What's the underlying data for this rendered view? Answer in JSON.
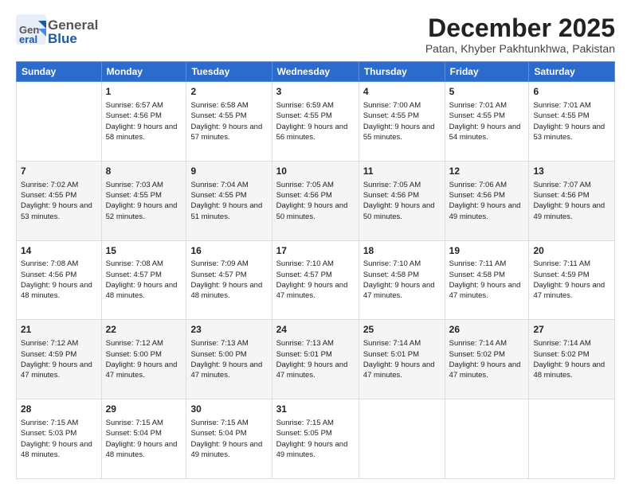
{
  "header": {
    "logo_general": "General",
    "logo_blue": "Blue",
    "month": "December 2025",
    "location": "Patan, Khyber Pakhtunkhwa, Pakistan"
  },
  "weekdays": [
    "Sunday",
    "Monday",
    "Tuesday",
    "Wednesday",
    "Thursday",
    "Friday",
    "Saturday"
  ],
  "weeks": [
    [
      {
        "day": "",
        "sunrise": "",
        "sunset": "",
        "daylight": ""
      },
      {
        "day": "1",
        "sunrise": "Sunrise: 6:57 AM",
        "sunset": "Sunset: 4:56 PM",
        "daylight": "Daylight: 9 hours and 58 minutes."
      },
      {
        "day": "2",
        "sunrise": "Sunrise: 6:58 AM",
        "sunset": "Sunset: 4:55 PM",
        "daylight": "Daylight: 9 hours and 57 minutes."
      },
      {
        "day": "3",
        "sunrise": "Sunrise: 6:59 AM",
        "sunset": "Sunset: 4:55 PM",
        "daylight": "Daylight: 9 hours and 56 minutes."
      },
      {
        "day": "4",
        "sunrise": "Sunrise: 7:00 AM",
        "sunset": "Sunset: 4:55 PM",
        "daylight": "Daylight: 9 hours and 55 minutes."
      },
      {
        "day": "5",
        "sunrise": "Sunrise: 7:01 AM",
        "sunset": "Sunset: 4:55 PM",
        "daylight": "Daylight: 9 hours and 54 minutes."
      },
      {
        "day": "6",
        "sunrise": "Sunrise: 7:01 AM",
        "sunset": "Sunset: 4:55 PM",
        "daylight": "Daylight: 9 hours and 53 minutes."
      }
    ],
    [
      {
        "day": "7",
        "sunrise": "Sunrise: 7:02 AM",
        "sunset": "Sunset: 4:55 PM",
        "daylight": "Daylight: 9 hours and 53 minutes."
      },
      {
        "day": "8",
        "sunrise": "Sunrise: 7:03 AM",
        "sunset": "Sunset: 4:55 PM",
        "daylight": "Daylight: 9 hours and 52 minutes."
      },
      {
        "day": "9",
        "sunrise": "Sunrise: 7:04 AM",
        "sunset": "Sunset: 4:55 PM",
        "daylight": "Daylight: 9 hours and 51 minutes."
      },
      {
        "day": "10",
        "sunrise": "Sunrise: 7:05 AM",
        "sunset": "Sunset: 4:56 PM",
        "daylight": "Daylight: 9 hours and 50 minutes."
      },
      {
        "day": "11",
        "sunrise": "Sunrise: 7:05 AM",
        "sunset": "Sunset: 4:56 PM",
        "daylight": "Daylight: 9 hours and 50 minutes."
      },
      {
        "day": "12",
        "sunrise": "Sunrise: 7:06 AM",
        "sunset": "Sunset: 4:56 PM",
        "daylight": "Daylight: 9 hours and 49 minutes."
      },
      {
        "day": "13",
        "sunrise": "Sunrise: 7:07 AM",
        "sunset": "Sunset: 4:56 PM",
        "daylight": "Daylight: 9 hours and 49 minutes."
      }
    ],
    [
      {
        "day": "14",
        "sunrise": "Sunrise: 7:08 AM",
        "sunset": "Sunset: 4:56 PM",
        "daylight": "Daylight: 9 hours and 48 minutes."
      },
      {
        "day": "15",
        "sunrise": "Sunrise: 7:08 AM",
        "sunset": "Sunset: 4:57 PM",
        "daylight": "Daylight: 9 hours and 48 minutes."
      },
      {
        "day": "16",
        "sunrise": "Sunrise: 7:09 AM",
        "sunset": "Sunset: 4:57 PM",
        "daylight": "Daylight: 9 hours and 48 minutes."
      },
      {
        "day": "17",
        "sunrise": "Sunrise: 7:10 AM",
        "sunset": "Sunset: 4:57 PM",
        "daylight": "Daylight: 9 hours and 47 minutes."
      },
      {
        "day": "18",
        "sunrise": "Sunrise: 7:10 AM",
        "sunset": "Sunset: 4:58 PM",
        "daylight": "Daylight: 9 hours and 47 minutes."
      },
      {
        "day": "19",
        "sunrise": "Sunrise: 7:11 AM",
        "sunset": "Sunset: 4:58 PM",
        "daylight": "Daylight: 9 hours and 47 minutes."
      },
      {
        "day": "20",
        "sunrise": "Sunrise: 7:11 AM",
        "sunset": "Sunset: 4:59 PM",
        "daylight": "Daylight: 9 hours and 47 minutes."
      }
    ],
    [
      {
        "day": "21",
        "sunrise": "Sunrise: 7:12 AM",
        "sunset": "Sunset: 4:59 PM",
        "daylight": "Daylight: 9 hours and 47 minutes."
      },
      {
        "day": "22",
        "sunrise": "Sunrise: 7:12 AM",
        "sunset": "Sunset: 5:00 PM",
        "daylight": "Daylight: 9 hours and 47 minutes."
      },
      {
        "day": "23",
        "sunrise": "Sunrise: 7:13 AM",
        "sunset": "Sunset: 5:00 PM",
        "daylight": "Daylight: 9 hours and 47 minutes."
      },
      {
        "day": "24",
        "sunrise": "Sunrise: 7:13 AM",
        "sunset": "Sunset: 5:01 PM",
        "daylight": "Daylight: 9 hours and 47 minutes."
      },
      {
        "day": "25",
        "sunrise": "Sunrise: 7:14 AM",
        "sunset": "Sunset: 5:01 PM",
        "daylight": "Daylight: 9 hours and 47 minutes."
      },
      {
        "day": "26",
        "sunrise": "Sunrise: 7:14 AM",
        "sunset": "Sunset: 5:02 PM",
        "daylight": "Daylight: 9 hours and 47 minutes."
      },
      {
        "day": "27",
        "sunrise": "Sunrise: 7:14 AM",
        "sunset": "Sunset: 5:02 PM",
        "daylight": "Daylight: 9 hours and 48 minutes."
      }
    ],
    [
      {
        "day": "28",
        "sunrise": "Sunrise: 7:15 AM",
        "sunset": "Sunset: 5:03 PM",
        "daylight": "Daylight: 9 hours and 48 minutes."
      },
      {
        "day": "29",
        "sunrise": "Sunrise: 7:15 AM",
        "sunset": "Sunset: 5:04 PM",
        "daylight": "Daylight: 9 hours and 48 minutes."
      },
      {
        "day": "30",
        "sunrise": "Sunrise: 7:15 AM",
        "sunset": "Sunset: 5:04 PM",
        "daylight": "Daylight: 9 hours and 49 minutes."
      },
      {
        "day": "31",
        "sunrise": "Sunrise: 7:15 AM",
        "sunset": "Sunset: 5:05 PM",
        "daylight": "Daylight: 9 hours and 49 minutes."
      },
      {
        "day": "",
        "sunrise": "",
        "sunset": "",
        "daylight": ""
      },
      {
        "day": "",
        "sunrise": "",
        "sunset": "",
        "daylight": ""
      },
      {
        "day": "",
        "sunrise": "",
        "sunset": "",
        "daylight": ""
      }
    ]
  ]
}
